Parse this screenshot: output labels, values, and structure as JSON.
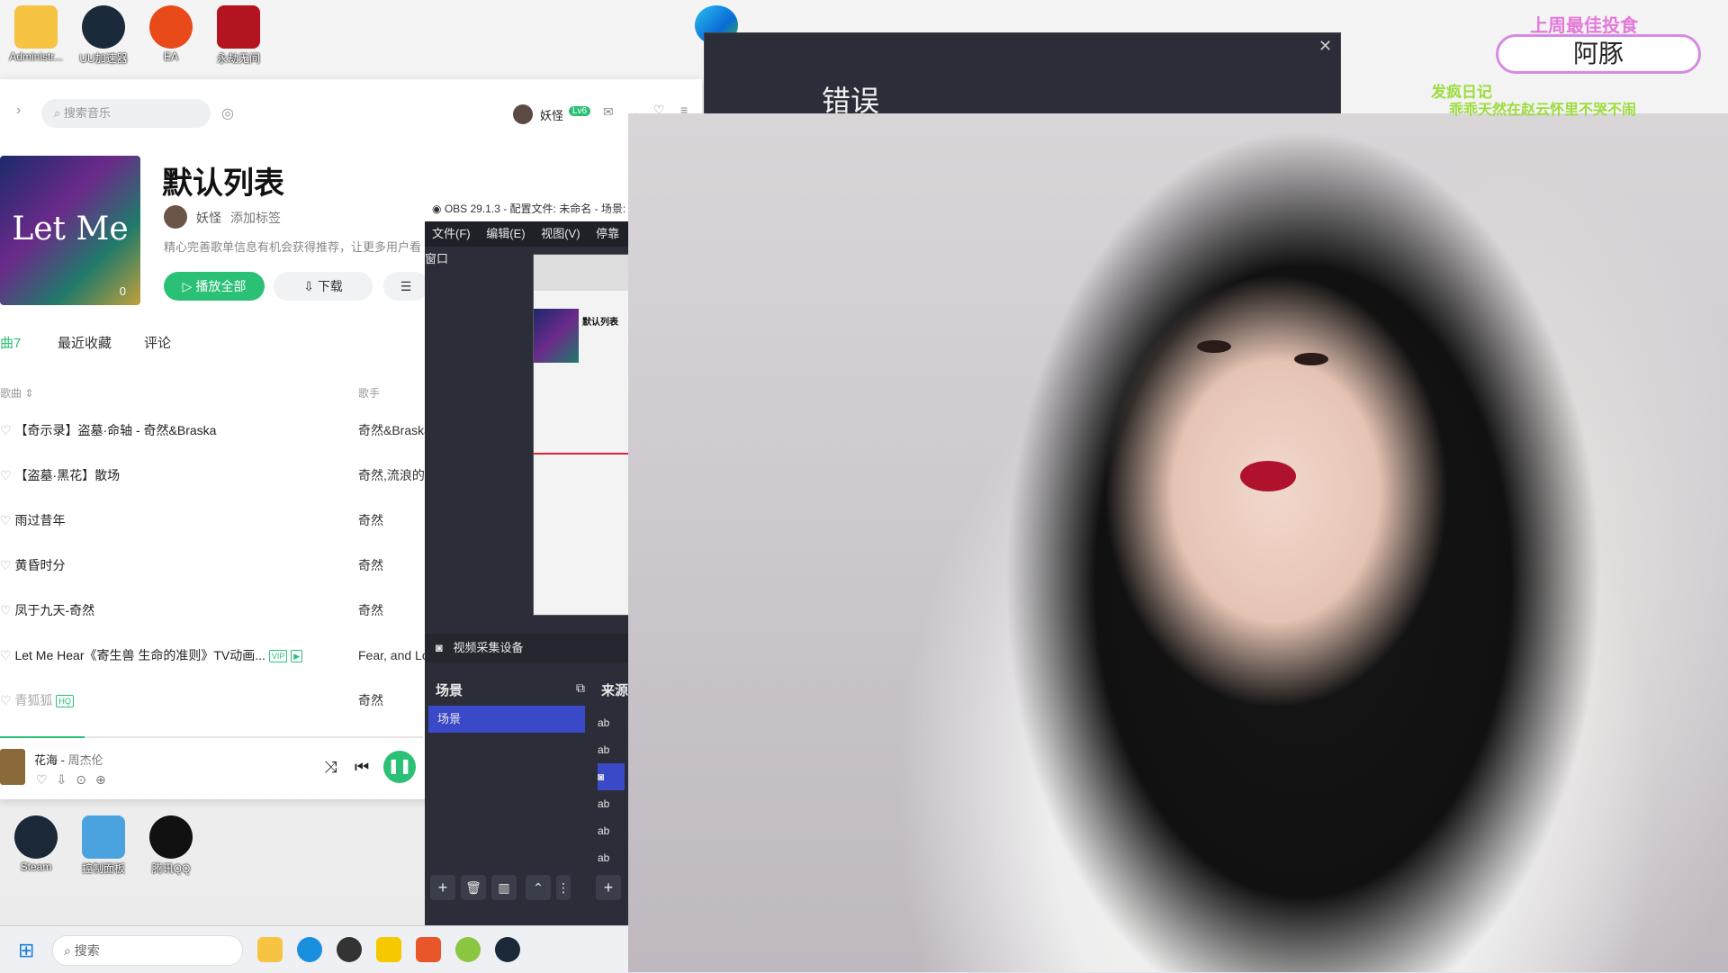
{
  "desktop_icons": [
    "Administr...",
    "UU加速器",
    "EA",
    "永劫无间",
    "Steam",
    "控制面板",
    "腾讯QQ"
  ],
  "music_app": {
    "search_placeholder": "搜索音乐",
    "user_name": "妖怪",
    "vip_badge": "Lv6",
    "playlist_title": "默认列表",
    "cover_text": "Let Me Hear",
    "cover_play_count": "0",
    "owner": "妖怪",
    "add_tag": "添加标签",
    "description": "精心完善歌单信息有机会获得推荐，让更多用户看",
    "play_all": "播放全部",
    "download": "下载",
    "tabs": [
      "曲7",
      "最近收藏",
      "评论"
    ],
    "col_song": "歌曲",
    "col_artist": "歌手",
    "songs": [
      {
        "title": "【奇示录】盗墓·命轴 - 奇然&Braska",
        "artist": "奇然&Braska"
      },
      {
        "title": "【盗墓·黑花】散场",
        "artist": "奇然,流浪的蛙"
      },
      {
        "title": "雨过昔年",
        "artist": "奇然"
      },
      {
        "title": "黄昏时分",
        "artist": "奇然"
      },
      {
        "title": "凤于九天-奇然",
        "artist": "奇然"
      },
      {
        "title": "Let Me Hear《寄生兽 生命的准则》TV动画...",
        "artist": "Fear, and Lo"
      },
      {
        "title": "青狐狐",
        "artist": "奇然"
      }
    ],
    "now_playing": {
      "title": "花海",
      "artist": "周杰伦",
      "progress": 0.2
    }
  },
  "obs": {
    "window_title": "OBS 29.1.3 - 配置文件: 未命名 - 场景:",
    "menu": [
      "文件(F)",
      "编辑(E)",
      "视图(V)",
      "停靠窗口"
    ],
    "source_bar": "视频采集设备",
    "scenes_header": "场景",
    "sources_header": "来源",
    "scene_item": "场景",
    "source_types": [
      "ab",
      "ab",
      "cam",
      "ab",
      "ab",
      "ab"
    ],
    "preview_title": "默认列表"
  },
  "error_dialog": {
    "title": "错误"
  },
  "stream_overlay": {
    "line1": "上周最佳投食",
    "name": "阿豚",
    "line2": "发疯日记",
    "line3": "乖乖天然在赵云怀里不哭不闹"
  },
  "taskbar": {
    "search_placeholder": "搜索"
  },
  "colors": {
    "accent_green": "#2ac075",
    "obs_bg": "#2b2e38",
    "obs_selected": "#3a49c8",
    "overlay_pink": "#e37ad8",
    "overlay_green": "#9ddc3d"
  }
}
